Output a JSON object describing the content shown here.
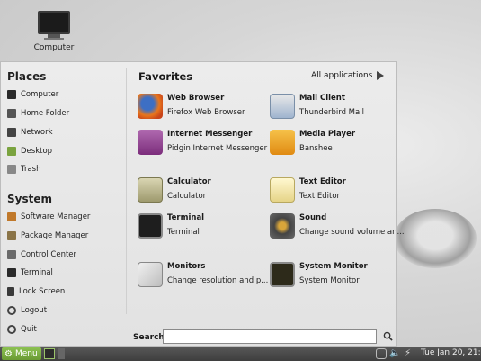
{
  "desktop": {
    "computer_label": "Computer"
  },
  "places": {
    "title": "Places",
    "items": [
      {
        "label": "Computer",
        "icon": "monitor-icon"
      },
      {
        "label": "Home Folder",
        "icon": "home-icon"
      },
      {
        "label": "Network",
        "icon": "network-icon"
      },
      {
        "label": "Desktop",
        "icon": "desktop-icon"
      },
      {
        "label": "Trash",
        "icon": "trash-icon"
      }
    ]
  },
  "system": {
    "title": "System",
    "items": [
      {
        "label": "Software Manager",
        "icon": "software-manager-icon"
      },
      {
        "label": "Package Manager",
        "icon": "package-manager-icon"
      },
      {
        "label": "Control Center",
        "icon": "control-center-icon"
      },
      {
        "label": "Terminal",
        "icon": "terminal-icon"
      },
      {
        "label": "Lock Screen",
        "icon": "lock-icon"
      },
      {
        "label": "Logout",
        "icon": "logout-icon"
      },
      {
        "label": "Quit",
        "icon": "power-icon"
      }
    ]
  },
  "favorites": {
    "title": "Favorites",
    "all_apps": "All applications",
    "apps": [
      {
        "name": "Web Browser",
        "desc": "Firefox Web Browser",
        "icon": "firefox-icon",
        "color": "#e8761c"
      },
      {
        "name": "Mail Client",
        "desc": "Thunderbird Mail",
        "icon": "thunderbird-icon",
        "color": "#4a7bb7"
      },
      {
        "name": "Internet Messenger",
        "desc": "Pidgin Internet Messenger",
        "icon": "pidgin-icon",
        "color": "#8e3c8e"
      },
      {
        "name": "Media Player",
        "desc": "Banshee",
        "icon": "banshee-icon",
        "color": "#f0a81c"
      },
      {
        "name": "Calculator",
        "desc": "Calculator",
        "icon": "calculator-icon",
        "color": "#b7b48a"
      },
      {
        "name": "Text Editor",
        "desc": "Text Editor",
        "icon": "text-editor-icon",
        "color": "#f2e6a0"
      },
      {
        "name": "Terminal",
        "desc": "Terminal",
        "icon": "terminal-icon",
        "color": "#2b2b2b"
      },
      {
        "name": "Sound",
        "desc": "Change sound volume an...",
        "icon": "speaker-icon",
        "color": "#5a5a5a"
      },
      {
        "name": "Monitors",
        "desc": "Change resolution and p...",
        "icon": "monitors-icon",
        "color": "#d9d9d9"
      },
      {
        "name": "System Monitor",
        "desc": "System Monitor",
        "icon": "system-monitor-icon",
        "color": "#3a3520"
      }
    ]
  },
  "search": {
    "label": "Search:",
    "value": ""
  },
  "panel": {
    "menu_label": "Menu",
    "clock": "Tue Jan 20, 21:25"
  }
}
